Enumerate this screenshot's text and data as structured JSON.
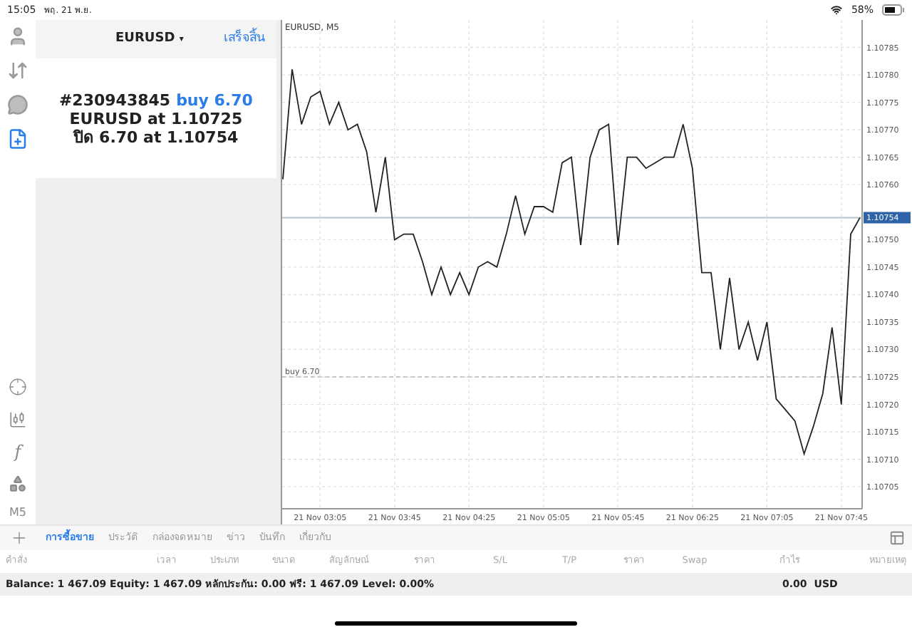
{
  "status_bar": {
    "time": "15:05",
    "date": "พฤ. 21 พ.ย.",
    "battery": "58%"
  },
  "left_tools": [
    {
      "selected": false
    },
    {
      "selected": false
    },
    {
      "selected": false
    },
    {
      "selected": true
    }
  ],
  "indicator_label": "f",
  "timeframe": "M5",
  "order_popup": {
    "symbol": "EURUSD",
    "caret": "▾",
    "done": "เสร็จสิ้น",
    "order_id": "#230943845",
    "action": "buy 6.70",
    "open_line": "EURUSD at 1.10725",
    "close_line": "ปิด 6.70 at 1.10754"
  },
  "chart": {
    "chart_data": {
      "type": "line",
      "title": "EURUSD, M5",
      "values": [
        1.10761,
        1.10781,
        1.10771,
        1.10776,
        1.10777,
        1.10771,
        1.10775,
        1.1077,
        1.10771,
        1.10766,
        1.10755,
        1.10765,
        1.1075,
        1.10751,
        1.10751,
        1.10746,
        1.1074,
        1.10745,
        1.1074,
        1.10744,
        1.1074,
        1.10745,
        1.10746,
        1.10745,
        1.10751,
        1.10758,
        1.10751,
        1.10756,
        1.10756,
        1.10755,
        1.10764,
        1.10765,
        1.10749,
        1.10765,
        1.1077,
        1.10771,
        1.10749,
        1.10765,
        1.10765,
        1.10763,
        1.10764,
        1.10765,
        1.10765,
        1.10771,
        1.10763,
        1.10744,
        1.10744,
        1.1073,
        1.10743,
        1.1073,
        1.10735,
        1.10728,
        1.10735,
        1.10721,
        1.10719,
        1.10717,
        1.10711,
        1.10716,
        1.10722,
        1.10734,
        1.1072,
        1.10751,
        1.10754
      ],
      "categories": [
        null,
        null,
        null,
        null,
        "21 Nov 03:05",
        null,
        null,
        null,
        null,
        null,
        null,
        null,
        "21 Nov 03:45",
        null,
        null,
        null,
        null,
        null,
        null,
        null,
        "21 Nov 04:25",
        null,
        null,
        null,
        null,
        null,
        null,
        null,
        "21 Nov 05:05",
        null,
        null,
        null,
        null,
        null,
        null,
        null,
        "21 Nov 05:45",
        null,
        null,
        null,
        null,
        null,
        null,
        null,
        "21 Nov 06:25",
        null,
        null,
        null,
        null,
        null,
        null,
        null,
        "21 Nov 07:05",
        null,
        null,
        null,
        null,
        null,
        null,
        null,
        "21 Nov 07:45",
        null,
        null
      ],
      "ylim": [
        1.10701,
        1.1079
      ],
      "grid": true,
      "yticks": [
        {
          "value": 1.10705,
          "label": "1.10705"
        },
        {
          "value": 1.1071,
          "label": "1.10710"
        },
        {
          "value": 1.10715,
          "label": "1.10715"
        },
        {
          "value": 1.1072,
          "label": "1.10720"
        },
        {
          "value": 1.10725,
          "label": "1.10725"
        },
        {
          "value": 1.1073,
          "label": "1.10730"
        },
        {
          "value": 1.10735,
          "label": "1.10735"
        },
        {
          "value": 1.1074,
          "label": "1.10740"
        },
        {
          "value": 1.10745,
          "label": "1.10745"
        },
        {
          "value": 1.1075,
          "label": "1.10750"
        },
        {
          "value": 1.1076,
          "label": "1.10760"
        },
        {
          "value": 1.10765,
          "label": "1.10765"
        },
        {
          "value": 1.1077,
          "label": "1.10770"
        },
        {
          "value": 1.10775,
          "label": "1.10775"
        },
        {
          "value": 1.1078,
          "label": "1.10780"
        },
        {
          "value": 1.10785,
          "label": "1.10785"
        }
      ],
      "ref_lines": [
        {
          "axis": "y",
          "value": 1.10754,
          "label": "1.10754"
        },
        {
          "axis": "y",
          "value": 1.10725,
          "label": "buy 6.70"
        }
      ]
    }
  },
  "tabs": [
    {
      "label": "การซื้อขาย",
      "selected": true
    },
    {
      "label": "ประวัติ",
      "selected": false
    },
    {
      "label": "กล่องจดหมาย",
      "selected": false
    },
    {
      "label": "ข่าว",
      "selected": false
    },
    {
      "label": "บันทึก",
      "selected": false
    },
    {
      "label": "เกี่ยวกับ",
      "selected": false
    }
  ],
  "table": {
    "columns": [
      "คำสั่ง",
      "เวลา",
      "ประเภท",
      "ขนาด",
      "สัญลักษณ์",
      "ราคา",
      "S/L",
      "T/P",
      "ราคา",
      "Swap",
      "กำไร",
      "หมายเหตุ"
    ],
    "summary": {
      "text": "Balance: 1 467.09 Equity: 1 467.09 หลักประกัน: 0.00 ฟรี: 1 467.09 Level: 0.00%",
      "profit": "0.00",
      "currency": "USD"
    }
  }
}
